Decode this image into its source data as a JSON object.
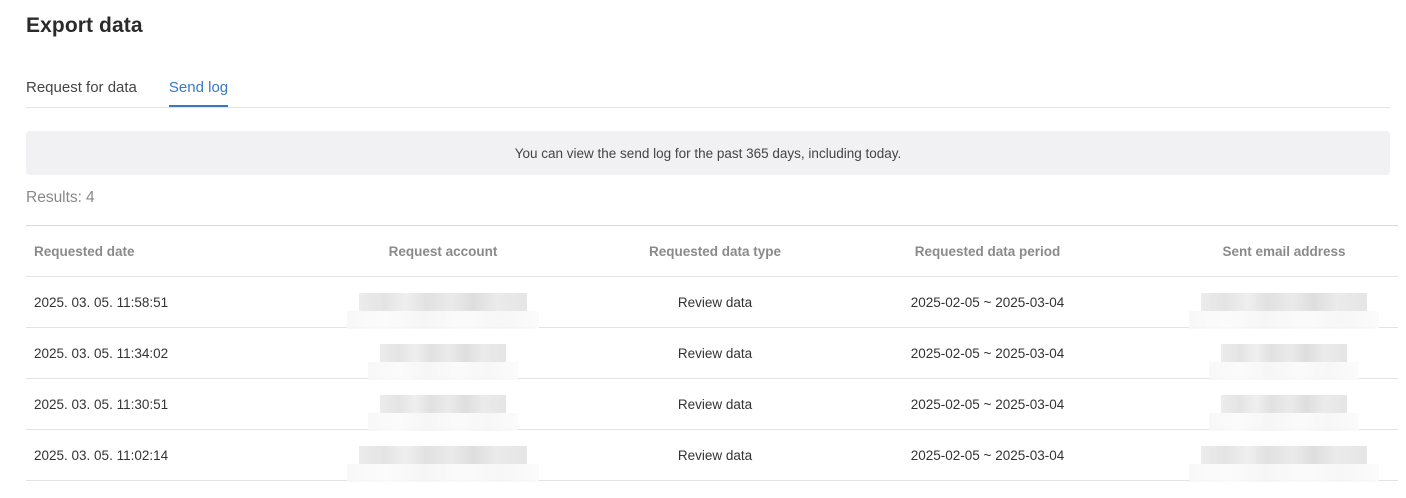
{
  "page": {
    "title": "Export data"
  },
  "tabs": [
    {
      "label": "Request for data",
      "active": false
    },
    {
      "label": "Send log",
      "active": true
    }
  ],
  "notice": {
    "text": "You can view the send log for the past 365 days, including today."
  },
  "results": {
    "label": "Results:",
    "count": "4"
  },
  "table": {
    "headers": {
      "requested_date": "Requested date",
      "request_account": "Request account",
      "requested_data_type": "Requested data type",
      "requested_data_period": "Requested data period",
      "sent_email_address": "Sent email address"
    },
    "rows": [
      {
        "date": "2025. 03. 05. 11:58:51",
        "type": "Review data",
        "period": "2025-02-05 ~ 2025-03-04"
      },
      {
        "date": "2025. 03. 05. 11:34:02",
        "type": "Review data",
        "period": "2025-02-05 ~ 2025-03-04"
      },
      {
        "date": "2025. 03. 05. 11:30:51",
        "type": "Review data",
        "period": "2025-02-05 ~ 2025-03-04"
      },
      {
        "date": "2025. 03. 05. 11:02:14",
        "type": "Review data",
        "period": "2025-02-05 ~ 2025-03-04"
      }
    ]
  },
  "colors": {
    "accent": "#3a78c3",
    "notice_bg": "#f1f1f3",
    "border": "#e3e3e3"
  }
}
